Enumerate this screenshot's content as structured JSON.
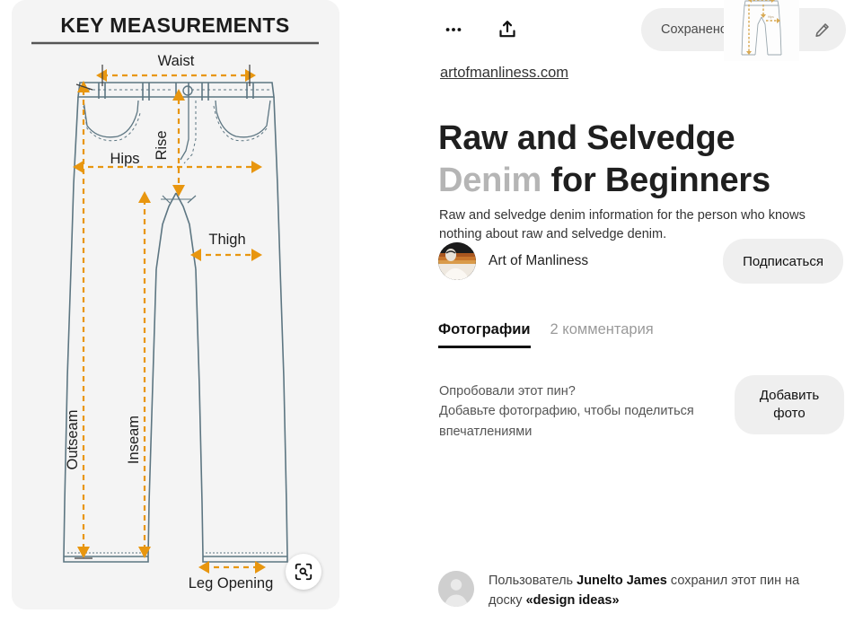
{
  "pin": {
    "image_alt": "KEY MEASUREMENTS jeans diagram",
    "domain_link": "artofmanliness.com",
    "title_lead": "Raw and Selvedge ",
    "title_dim": "Denim",
    "title_rest": " for Beginners",
    "title_full": "Raw and Selvedge Denim for Beginners",
    "description": "Raw and selvedge denim information for the person who knows nothing about raw and selvedge denim."
  },
  "diagram": {
    "heading": "KEY MEASUREMENTS",
    "labels": {
      "waist": "Waist",
      "rise": "Rise",
      "hips": "Hips",
      "thigh": "Thigh",
      "outseam": "Outseam",
      "inseam": "Inseam",
      "leg_opening": "Leg Opening"
    },
    "colors": {
      "background": "#f4f4f4",
      "measure_arrow": "#e8960f",
      "garment_outline": "#5d7682",
      "text": "#1c1c1c"
    }
  },
  "toolbar": {
    "more_options_label": "...",
    "share_label": "share",
    "saved_pill_text": "Сохранено: «Se",
    "edit_label": "edit"
  },
  "creator": {
    "name": "Art of Manliness",
    "follow_label": "Подписаться"
  },
  "tabs": [
    {
      "label": "Фотографии",
      "active": true
    },
    {
      "label": "2 комментария",
      "active": false
    }
  ],
  "tried_it": {
    "question": "Опробовали этот пин?",
    "prompt": "Добавьте фотографию, чтобы поделиться впечатлениями",
    "add_photo_line1": "Добавить",
    "add_photo_line2": "фото"
  },
  "saver": {
    "prefix": "Пользователь ",
    "user": "Junelto James",
    "middle": " сохранил этот пин на доску ",
    "board": "«design ideas»"
  }
}
